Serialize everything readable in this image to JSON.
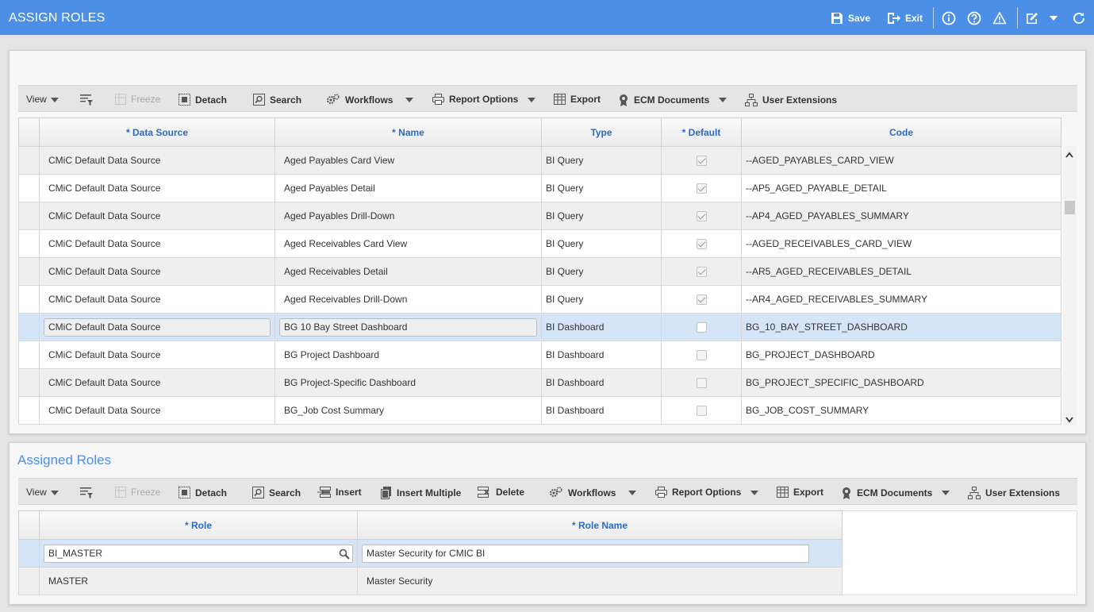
{
  "window": {
    "title": "ASSIGN ROLES",
    "save_label": "Save",
    "exit_label": "Exit"
  },
  "top_toolbar": {
    "view": "View",
    "freeze": "Freeze",
    "detach": "Detach",
    "search": "Search",
    "workflows": "Workflows",
    "report_options": "Report Options",
    "export": "Export",
    "ecm_documents": "ECM Documents",
    "user_extensions": "User Extensions"
  },
  "data_grid": {
    "columns": [
      "* Data Source",
      "* Name",
      "Type",
      "* Default",
      "Code"
    ],
    "rows": [
      {
        "data_source": "CMiC Default Data Source",
        "name": "Aged Payables Card View",
        "type": "BI Query",
        "default": true,
        "code": "--AGED_PAYABLES_CARD_VIEW"
      },
      {
        "data_source": "CMiC Default Data Source",
        "name": "Aged Payables Detail",
        "type": "BI Query",
        "default": true,
        "code": "--AP5_AGED_PAYABLE_DETAIL"
      },
      {
        "data_source": "CMiC Default Data Source",
        "name": "Aged Payables Drill-Down",
        "type": "BI Query",
        "default": true,
        "code": "--AP4_AGED_PAYABLES_SUMMARY"
      },
      {
        "data_source": "CMiC Default Data Source",
        "name": "Aged Receivables Card View",
        "type": "BI Query",
        "default": true,
        "code": "--AGED_RECEIVABLES_CARD_VIEW"
      },
      {
        "data_source": "CMiC Default Data Source",
        "name": "Aged Receivables Detail",
        "type": "BI Query",
        "default": true,
        "code": "--AR5_AGED_RECEIVABLES_DETAIL"
      },
      {
        "data_source": "CMiC Default Data Source",
        "name": "Aged Receivables Drill-Down",
        "type": "BI Query",
        "default": true,
        "code": "--AR4_AGED_RECEIVABLES_SUMMARY"
      },
      {
        "data_source": "CMiC Default Data Source",
        "name": "BG 10 Bay Street Dashboard",
        "type": "BI Dashboard",
        "default": false,
        "code": "BG_10_BAY_STREET_DASHBOARD"
      },
      {
        "data_source": "CMiC Default Data Source",
        "name": "BG Project Dashboard",
        "type": "BI Dashboard",
        "default": false,
        "code": "BG_PROJECT_DASHBOARD"
      },
      {
        "data_source": "CMiC Default Data Source",
        "name": "BG Project-Specific Dashboard",
        "type": "BI Dashboard",
        "default": false,
        "code": "BG_PROJECT_SPECIFIC_DASHBOARD"
      },
      {
        "data_source": "CMiC Default Data Source",
        "name": "BG_Job Cost Summary",
        "type": "BI Dashboard",
        "default": false,
        "code": "BG_JOB_COST_SUMMARY"
      }
    ]
  },
  "assigned_roles": {
    "title": "Assigned Roles",
    "toolbar": {
      "view": "View",
      "freeze": "Freeze",
      "detach": "Detach",
      "search": "Search",
      "insert": "Insert",
      "insert_multiple": "Insert Multiple",
      "delete": "Delete",
      "workflows": "Workflows",
      "report_options": "Report Options",
      "export": "Export",
      "ecm_documents": "ECM Documents",
      "user_extensions": "User Extensions"
    },
    "columns": [
      "* Role",
      "* Role Name"
    ],
    "rows": [
      {
        "role": "BI_MASTER",
        "role_name": "Master Security for CMIC BI"
      },
      {
        "role": "MASTER",
        "role_name": "Master Security"
      }
    ]
  }
}
